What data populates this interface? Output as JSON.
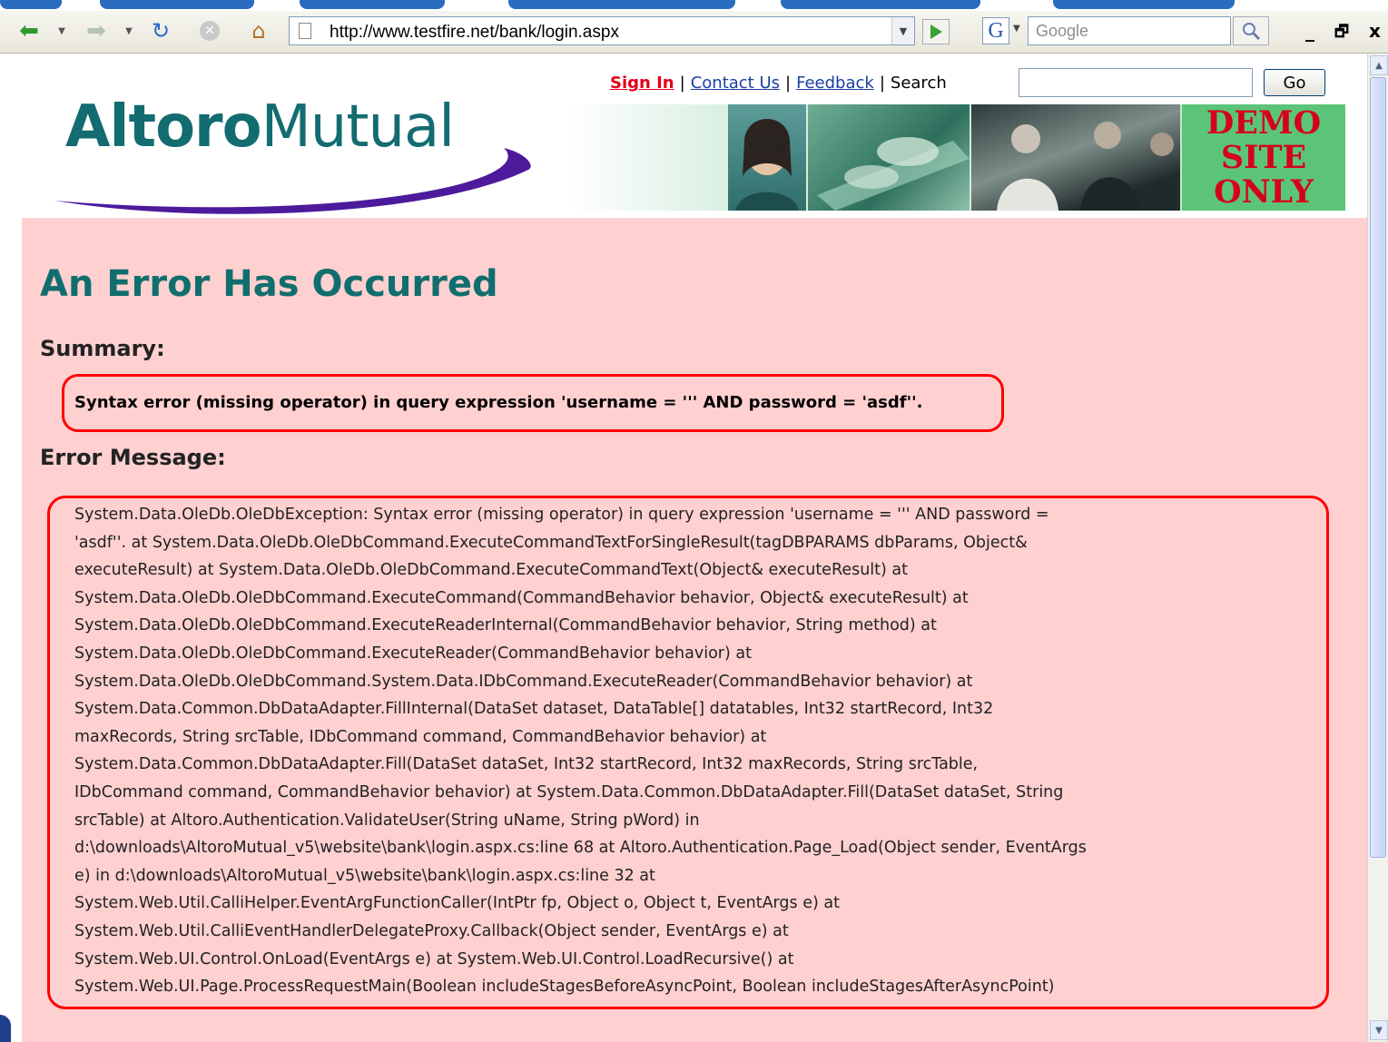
{
  "browser": {
    "url": "http://www.testfire.net/bank/login.aspx",
    "search_placeholder": "Google",
    "search_engine_glyph": "G",
    "window_controls": {
      "minimize": "_",
      "restore": "🗗",
      "close": "x"
    }
  },
  "header": {
    "links": {
      "sign_in": "Sign In",
      "contact_us": "Contact Us",
      "feedback": "Feedback",
      "search_label": "Search"
    },
    "separator": "|",
    "go_button": "Go",
    "logo": {
      "bold": "Altoro",
      "light": "Mutual"
    },
    "demo_lines": [
      "DEMO",
      "SITE",
      "ONLY"
    ]
  },
  "error": {
    "title": "An Error Has Occurred",
    "summary_heading": "Summary:",
    "summary_text": "Syntax error (missing operator) in query expression 'username = ''' AND password = 'asdf''.",
    "message_heading": "Error Message:",
    "message_lines": [
      "System.Data.OleDb.OleDbException: Syntax error (missing operator) in query expression 'username = ''' AND password =",
      "'asdf''. at System.Data.OleDb.OleDbCommand.ExecuteCommandTextForSingleResult(tagDBPARAMS dbParams, Object&",
      "executeResult) at System.Data.OleDb.OleDbCommand.ExecuteCommandText(Object& executeResult) at",
      "System.Data.OleDb.OleDbCommand.ExecuteCommand(CommandBehavior behavior, Object& executeResult) at",
      "System.Data.OleDb.OleDbCommand.ExecuteReaderInternal(CommandBehavior behavior, String method) at",
      "System.Data.OleDb.OleDbCommand.ExecuteReader(CommandBehavior behavior) at",
      "System.Data.OleDb.OleDbCommand.System.Data.IDbCommand.ExecuteReader(CommandBehavior behavior) at",
      "System.Data.Common.DbDataAdapter.FillInternal(DataSet dataset, DataTable[] datatables, Int32 startRecord, Int32",
      "maxRecords, String srcTable, IDbCommand command, CommandBehavior behavior) at",
      "System.Data.Common.DbDataAdapter.Fill(DataSet dataSet, Int32 startRecord, Int32 maxRecords, String srcTable,",
      "IDbCommand command, CommandBehavior behavior) at System.Data.Common.DbDataAdapter.Fill(DataSet dataSet, String",
      "srcTable) at Altoro.Authentication.ValidateUser(String uName, String pWord) in",
      "d:\\downloads\\AltoroMutual_v5\\website\\bank\\login.aspx.cs:line 68 at Altoro.Authentication.Page_Load(Object sender, EventArgs",
      "e) in d:\\downloads\\AltoroMutual_v5\\website\\bank\\login.aspx.cs:line 32 at",
      "System.Web.Util.CalliHelper.EventArgFunctionCaller(IntPtr fp, Object o, Object t, EventArgs e) at",
      "System.Web.Util.CalliEventHandlerDelegateProxy.Callback(Object sender, EventArgs e) at",
      "System.Web.UI.Control.OnLoad(EventArgs e) at System.Web.UI.Control.LoadRecursive() at",
      "System.Web.UI.Page.ProcessRequestMain(Boolean includeStagesBeforeAsyncPoint, Boolean includeStagesAfterAsyncPoint)"
    ]
  },
  "icons": [
    "back-icon",
    "forward-icon",
    "refresh-icon",
    "stop-icon",
    "home-icon",
    "page-icon",
    "go-arrow-icon",
    "search-icon"
  ],
  "colors": {
    "content_bg": "#ffd0d0",
    "heading": "#116e6e",
    "highlight": "#ff0000",
    "sign_in": "#e0001b",
    "demo_bg": "#5cc478"
  }
}
